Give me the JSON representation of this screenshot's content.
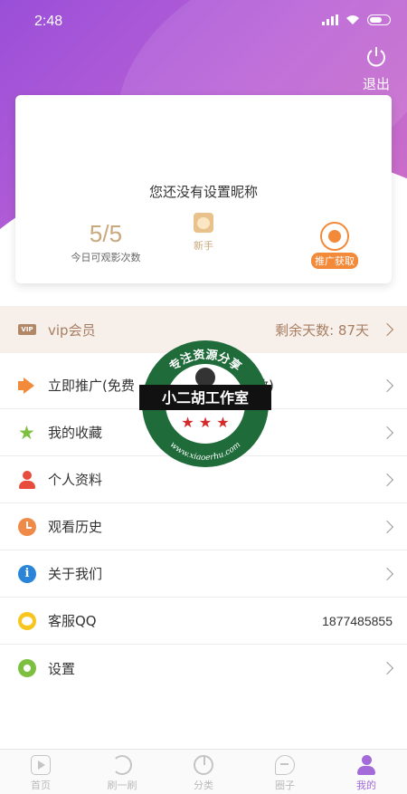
{
  "status_bar": {
    "time": "2:48"
  },
  "header": {
    "logout_label": "退出"
  },
  "profile": {
    "nickname_prompt": "您还没有设置昵称",
    "views": {
      "value": "5/5",
      "label": "今日可观影次数"
    },
    "level": {
      "label": "新手",
      "icon": "dog-avatar-icon"
    },
    "promo": {
      "label": "推广获取",
      "icon": "share-icon"
    }
  },
  "vip": {
    "label": "vip会员",
    "tag": "VIP",
    "days": "剩余天数: 87天"
  },
  "menu": [
    {
      "label": "立即推广(免费",
      "label_tail": "数)",
      "icon": "megaphone-icon",
      "value": ""
    },
    {
      "label": "我的收藏",
      "icon": "star-icon",
      "value": ""
    },
    {
      "label": "个人资料",
      "icon": "person-icon",
      "value": ""
    },
    {
      "label": "观看历史",
      "icon": "clock-icon",
      "value": ""
    },
    {
      "label": "关于我们",
      "icon": "info-icon",
      "value": ""
    },
    {
      "label": "客服QQ",
      "icon": "qq-icon",
      "value": "1877485855"
    },
    {
      "label": "设置",
      "icon": "gear-icon",
      "value": ""
    }
  ],
  "watermark": {
    "top_text": "专注资源分享",
    "title": "小二胡工作室",
    "url": "www.xiaoerhu.com"
  },
  "bottom_nav": [
    {
      "label": "首页",
      "icon": "home-play-icon",
      "active": false
    },
    {
      "label": "刷一刷",
      "icon": "refresh-icon",
      "active": false
    },
    {
      "label": "分类",
      "icon": "pie-chart-icon",
      "active": false
    },
    {
      "label": "圈子",
      "icon": "chat-bubble-icon",
      "active": false
    },
    {
      "label": "我的",
      "icon": "user-icon",
      "active": true
    }
  ],
  "colors": {
    "accent": "#a36ad9",
    "gold": "#c9a87c",
    "orange": "#f28a3a",
    "vip_bg": "#f7efe9"
  }
}
